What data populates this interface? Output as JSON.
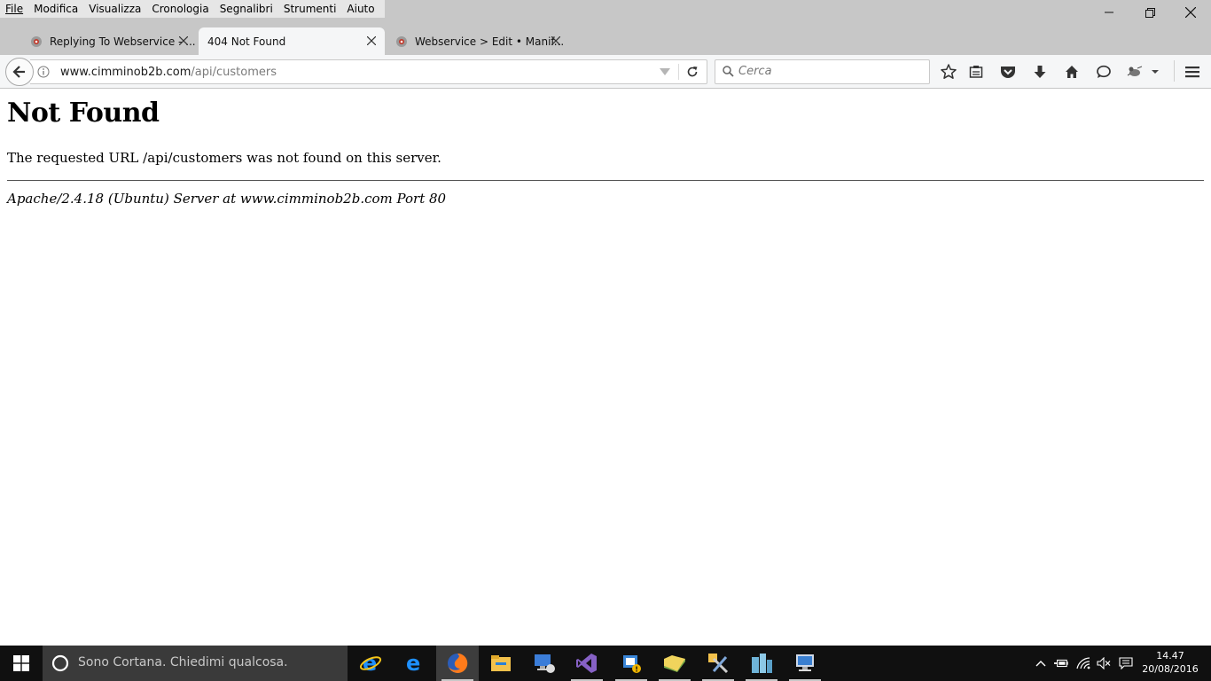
{
  "menubar": {
    "items": [
      {
        "label": "File"
      },
      {
        "label": "Modifica"
      },
      {
        "label": "Visualizza"
      },
      {
        "label": "Cronologia"
      },
      {
        "label": "Segnalibri"
      },
      {
        "label": "Strumenti"
      },
      {
        "label": "Aiuto"
      }
    ]
  },
  "tabs": [
    {
      "title": "Replying To Webservice - ...",
      "icon": "joomla-favicon",
      "active": false
    },
    {
      "title": "404 Not Found",
      "icon": "",
      "active": true
    },
    {
      "title": "Webservice > Edit • Manif...",
      "icon": "joomla-favicon",
      "active": false
    }
  ],
  "navbar": {
    "url_host": "www.cimminob2b.com",
    "url_path": "/api/customers",
    "search_placeholder": "Cerca",
    "toolbar_icons": [
      "bookmark-star-icon",
      "reading-list-icon",
      "pocket-icon",
      "download-icon",
      "home-icon",
      "chat-icon",
      "addon-icon",
      "overflow-menu-icon",
      "hamburger-menu-icon"
    ]
  },
  "page": {
    "title": "Not Found",
    "message": "The requested URL /api/customers was not found on this server.",
    "address": "Apache/2.4.18 (Ubuntu) Server at www.cimminob2b.com Port 80"
  },
  "taskbar": {
    "cortana_placeholder": "Sono Cortana. Chiedimi qualcosa.",
    "apps": [
      "internet-explorer-icon",
      "edge-icon",
      "firefox-icon",
      "file-explorer-icon",
      "remote-desktop-icon",
      "visual-studio-icon",
      "app-notice-icon",
      "folder-yellow-icon",
      "tools-icon",
      "buildings-icon",
      "computer-icon"
    ],
    "clock_time": "14.47",
    "clock_date": "20/08/2016"
  },
  "colors": {
    "chrome_bg": "#c7c7c7",
    "navbar_bg": "#f5f6f7",
    "taskbar_bg": "#101010",
    "cortana_bg": "#3a3a3a",
    "accent_blue": "#0078d7"
  }
}
